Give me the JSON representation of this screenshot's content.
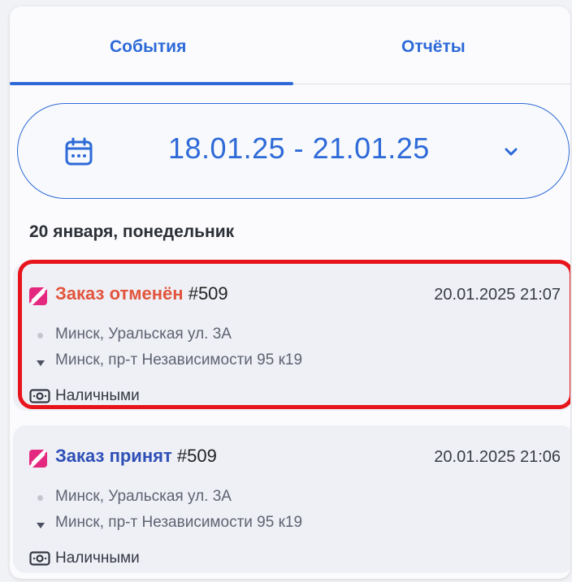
{
  "tabs": {
    "events": "События",
    "reports": "Отчёты"
  },
  "date_range": {
    "value": "18.01.25 - 21.01.25"
  },
  "day_header": "20 января, понедельник",
  "events": [
    {
      "status": "Заказ отменён",
      "number": "#509",
      "timestamp": "20.01.2025 21:07",
      "from": "Минск, Уральская ул. 3А",
      "to": "Минск, пр-т Независимости 95 к19",
      "payment": "Наличными",
      "status_color": "#e2543c",
      "highlighted": true
    },
    {
      "status": "Заказ принят",
      "number": "#509",
      "timestamp": "20.01.2025 21:06",
      "from": "Минск, Уральская ул. 3А",
      "to": "Минск, пр-т Независимости 95 к19",
      "payment": "Наличными",
      "status_color": "#2e4fb6",
      "highlighted": false
    }
  ],
  "colors": {
    "accent": "#2d6ad8",
    "highlight_border": "#e8141b",
    "brand_logo": "#e4287f"
  },
  "icons": {
    "date_picker": "calendar-icon",
    "dropdown": "chevron-down-icon",
    "logo": "app-logo-icon",
    "from": "origin-dot-icon",
    "to": "destination-arrow-icon",
    "payment": "cash-icon"
  }
}
